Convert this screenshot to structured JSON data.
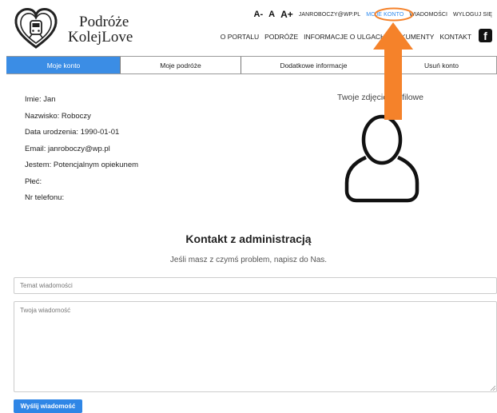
{
  "logo": {
    "line1": "Podróże",
    "line2": "KolejLove"
  },
  "util_bar": {
    "font_smaller": "A-",
    "font_normal": "A",
    "font_larger": "A+",
    "user_email": "JANROBOCZY@WP.PL",
    "my_account": "MOJE KONTO",
    "messages": "WIADOMOŚCI",
    "logout": "WYLOGUJ SIĘ"
  },
  "main_nav": [
    "O PORTALU",
    "PODRÓŻE",
    "INFORMACJE O ULGACH",
    "DOKUMENTY",
    "KONTAKT"
  ],
  "social": {
    "facebook_icon": "facebook-icon",
    "label": "f"
  },
  "tabs": [
    {
      "label": "Moje konto",
      "active": true
    },
    {
      "label": "Moje podróże",
      "active": false
    },
    {
      "label": "Dodatkowe informacje",
      "active": false
    },
    {
      "label": "Usuń konto",
      "active": false
    }
  ],
  "profile": {
    "name": "Imie: Jan",
    "surname": "Nazwisko: Roboczy",
    "birth_date": "Data urodzenia: 1990-01-01",
    "email": "Email: janroboczy@wp.pl",
    "role": "Jestem: Potencjalnym opiekunem",
    "gender": "Płeć:",
    "phone": "Nr telefonu:"
  },
  "photo": {
    "label": "Twoje zdjęcie profilowe",
    "icon": "user-avatar-icon"
  },
  "contact": {
    "title": "Kontakt z administracją",
    "subtitle": "Jeśli masz z czymś problem, napisz do Nas.",
    "subject_placeholder": "Temat wiadomości",
    "message_placeholder": "Twoja wiadomość",
    "send_label": "Wyślij wiadomość"
  },
  "colors": {
    "accent": "#3b8de5",
    "annotation": "#f5822a"
  }
}
